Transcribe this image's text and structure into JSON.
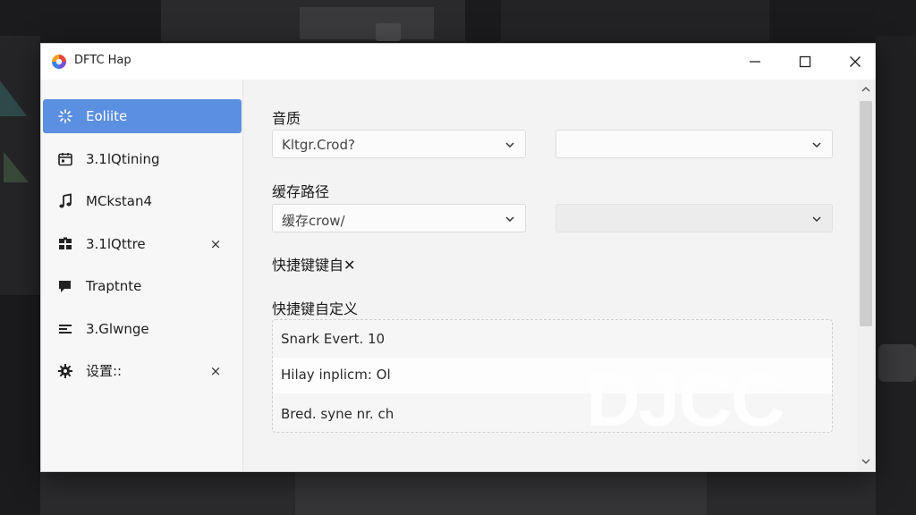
{
  "window": {
    "title": "DFTC Hap"
  },
  "sidebar": {
    "items": [
      {
        "label": "Eoliite",
        "icon": "sparkle-icon",
        "active": true,
        "closable": false
      },
      {
        "label": "3.1lQtining",
        "icon": "calendar-icon",
        "active": false,
        "closable": false
      },
      {
        "label": "MCkstan4",
        "icon": "music-note-icon",
        "active": false,
        "closable": false
      },
      {
        "label": "3.1lQttre",
        "icon": "grid-icon",
        "active": false,
        "closable": true
      },
      {
        "label": "Traptnte",
        "icon": "chat-icon",
        "active": false,
        "closable": false
      },
      {
        "label": "3.Glwnge",
        "icon": "list-icon",
        "active": false,
        "closable": false
      },
      {
        "label": "设置::",
        "icon": "gear-icon",
        "active": false,
        "closable": true
      }
    ],
    "close_glyph": "×"
  },
  "content": {
    "quality": {
      "label": "音质",
      "select1_value": "Kltgr.Crod?",
      "select2_value": ""
    },
    "cache": {
      "label": "缓存路径",
      "select1_value": "缓存crow/",
      "select2_value": ""
    },
    "shortcut_toggle_label": "快捷键键自✕",
    "shortcut_custom": {
      "label": "快捷键自定义",
      "rows": [
        {
          "text": "Snark Evert. 10"
        },
        {
          "text": "Hilay inplicm: Ol"
        },
        {
          "text": "Bred. syne nr. ch"
        }
      ]
    },
    "watermark": "DJCC"
  },
  "colors": {
    "accent": "#5b8fe0",
    "window_bg": "#f3f3f3",
    "titlebar_bg": "#ffffff"
  }
}
